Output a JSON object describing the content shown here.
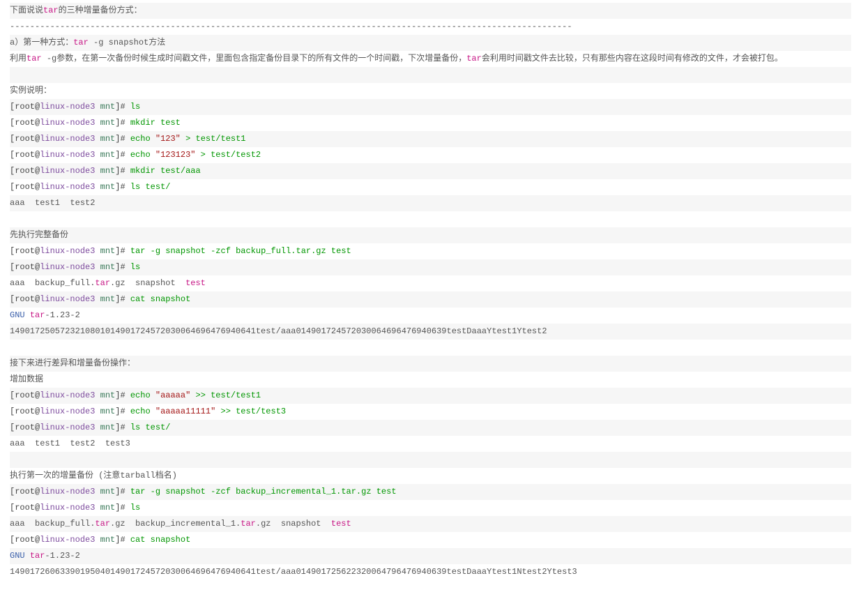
{
  "intro": {
    "p1a": "下面说说",
    "p1b": "的三种增量备份方式：",
    "rule": "----------------------------------------------------------------------------------------------------------------",
    "p2a": "a）第一种方式：",
    "p2b": " -g snapshot方法",
    "p3a": "利用",
    "p3b": " -g参数，在第一次备份时候生成时间戳文件，里面包含指定备份目录下的所有文件的一个时间戳，下次增量备份，",
    "p3c": "会利用时间戳文件去比较，只有那些内容在这段时间有修改的文件，才会被打包。"
  },
  "sec1": {
    "h": "实例说明：",
    "prompt_root": "[root@",
    "host": "linux-node3",
    "path": " mnt",
    "end": "]# ",
    "c1": "ls",
    "c2a": "mkdir",
    "c2b": " test",
    "c3a": "echo",
    "c3b": " > test/test1",
    "c3s": "\"123\"",
    "c4a": "echo",
    "c4b": " > test/test2",
    "c4s": "\"123123\"",
    "c5a": "mkdir",
    "c5b": " test/aaa",
    "c6a": "ls",
    "c6b": " test/",
    "out1": "aaa  test1  test2"
  },
  "sec2": {
    "h": "先执行完整备份",
    "c1a": "tar",
    "c1b": " -g snapshot -zcf backup_full.tar.gz test",
    "c2": "ls",
    "out2a": "aaa  backup_full.",
    "out2b": ".gz  snapshot  ",
    "out2c": "test",
    "c3a": "cat",
    "c3b": " snapshot",
    "gnu": "GNU ",
    "gnurest": "-1.23-2",
    "snap": "1490172505723210801014901724572030064696476940641test/aaa014901724572030064696476940639testDaaaYtest1Ytest2"
  },
  "sec3": {
    "h1": "接下来进行差异和增量备份操作：",
    "h2": "增加数据",
    "c1a": "echo",
    "c1s": "\"aaaaa\"",
    "c1b": " >> test/test1",
    "c2a": "echo",
    "c2s": "\"aaaaa11111\"",
    "c2b": " >> test/test3",
    "c3a": "ls",
    "c3b": " test/",
    "out": "aaa  test1  test2  test3"
  },
  "sec4": {
    "h": "执行第一次的增量备份 (注意tarball档名)",
    "c1a": "tar",
    "c1b": " -g snapshot -zcf backup_incremental_1.tar.gz test",
    "c2": "ls",
    "out2a": "aaa  backup_full.",
    "out2b": ".gz  backup_incremental_1.",
    "out2c": ".gz  snapshot  ",
    "out2d": "test",
    "c3a": "cat",
    "c3b": " snapshot",
    "gnu": "GNU ",
    "gnurest": "-1.23-2",
    "snap": "1490172606339019504014901724572030064696476940641test/aaa014901725622320064796476940639testDaaaYtest1Ntest2Ytest3"
  },
  "tar_word": "tar"
}
